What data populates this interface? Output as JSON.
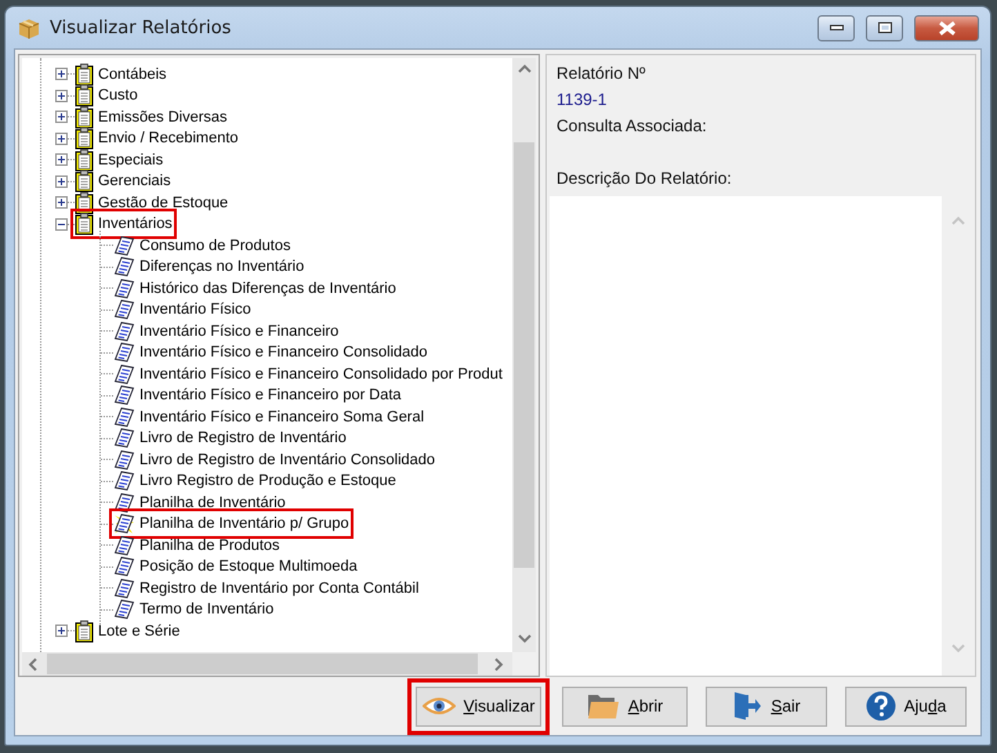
{
  "window": {
    "title": "Visualizar Relatórios"
  },
  "tree": [
    {
      "label": "Contábeis",
      "expanded": false,
      "highlighted": false
    },
    {
      "label": "Custo",
      "expanded": false,
      "highlighted": false
    },
    {
      "label": "Emissões Diversas",
      "expanded": false,
      "highlighted": false
    },
    {
      "label": "Envio / Recebimento",
      "expanded": false,
      "highlighted": false
    },
    {
      "label": "Especiais",
      "expanded": false,
      "highlighted": false
    },
    {
      "label": "Gerenciais",
      "expanded": false,
      "highlighted": false
    },
    {
      "label": "Gestão de Estoque",
      "expanded": false,
      "highlighted": false
    },
    {
      "label": "Inventários",
      "expanded": true,
      "highlighted": true,
      "children": [
        {
          "label": "Consumo de Produtos",
          "selected": false,
          "highlighted": false
        },
        {
          "label": "Diferenças no Inventário",
          "selected": false,
          "highlighted": false
        },
        {
          "label": "Histórico das Diferenças de Inventário",
          "selected": false,
          "highlighted": false
        },
        {
          "label": "Inventário Físico",
          "selected": false,
          "highlighted": false
        },
        {
          "label": "Inventário Físico e Financeiro",
          "selected": false,
          "highlighted": false
        },
        {
          "label": "Inventário Físico e Financeiro Consolidado",
          "selected": false,
          "highlighted": false
        },
        {
          "label": "Inventário Físico e Financeiro Consolidado por Produt",
          "selected": false,
          "highlighted": false
        },
        {
          "label": "Inventário Físico e Financeiro por Data",
          "selected": false,
          "highlighted": false
        },
        {
          "label": "Inventário Físico e Financeiro Soma Geral",
          "selected": false,
          "highlighted": false
        },
        {
          "label": "Livro de Registro de Inventário",
          "selected": false,
          "highlighted": false
        },
        {
          "label": "Livro de Registro de Inventário Consolidado",
          "selected": false,
          "highlighted": false
        },
        {
          "label": "Livro Registro de Produção e Estoque",
          "selected": false,
          "highlighted": false
        },
        {
          "label": "Planilha de Inventário",
          "selected": false,
          "highlighted": false
        },
        {
          "label": "Planilha de Inventário p/ Grupo",
          "selected": true,
          "highlighted": true
        },
        {
          "label": "Planilha de Produtos",
          "selected": false,
          "highlighted": false
        },
        {
          "label": "Posição de Estoque Multimoeda",
          "selected": false,
          "highlighted": false
        },
        {
          "label": "Registro de Inventário por Conta Contábil",
          "selected": false,
          "highlighted": false
        },
        {
          "label": "Termo de Inventário",
          "selected": false,
          "highlighted": false
        }
      ]
    },
    {
      "label": "Lote e Série",
      "expanded": false,
      "highlighted": false
    }
  ],
  "details": {
    "number_label": "Relatório Nº",
    "number": "1139-1",
    "query_label": "Consulta Associada:",
    "description_label": "Descrição Do Relatório:"
  },
  "buttons": [
    {
      "kind": "view",
      "key": "V",
      "post": "isualizar",
      "highlighted": true
    },
    {
      "kind": "open",
      "key": "A",
      "post": "brir",
      "highlighted": false
    },
    {
      "kind": "exit",
      "key": "S",
      "post": "air",
      "highlighted": false
    },
    {
      "kind": "help",
      "pre": "Aju",
      "key": "d",
      "post": "a",
      "highlighted": false
    }
  ]
}
